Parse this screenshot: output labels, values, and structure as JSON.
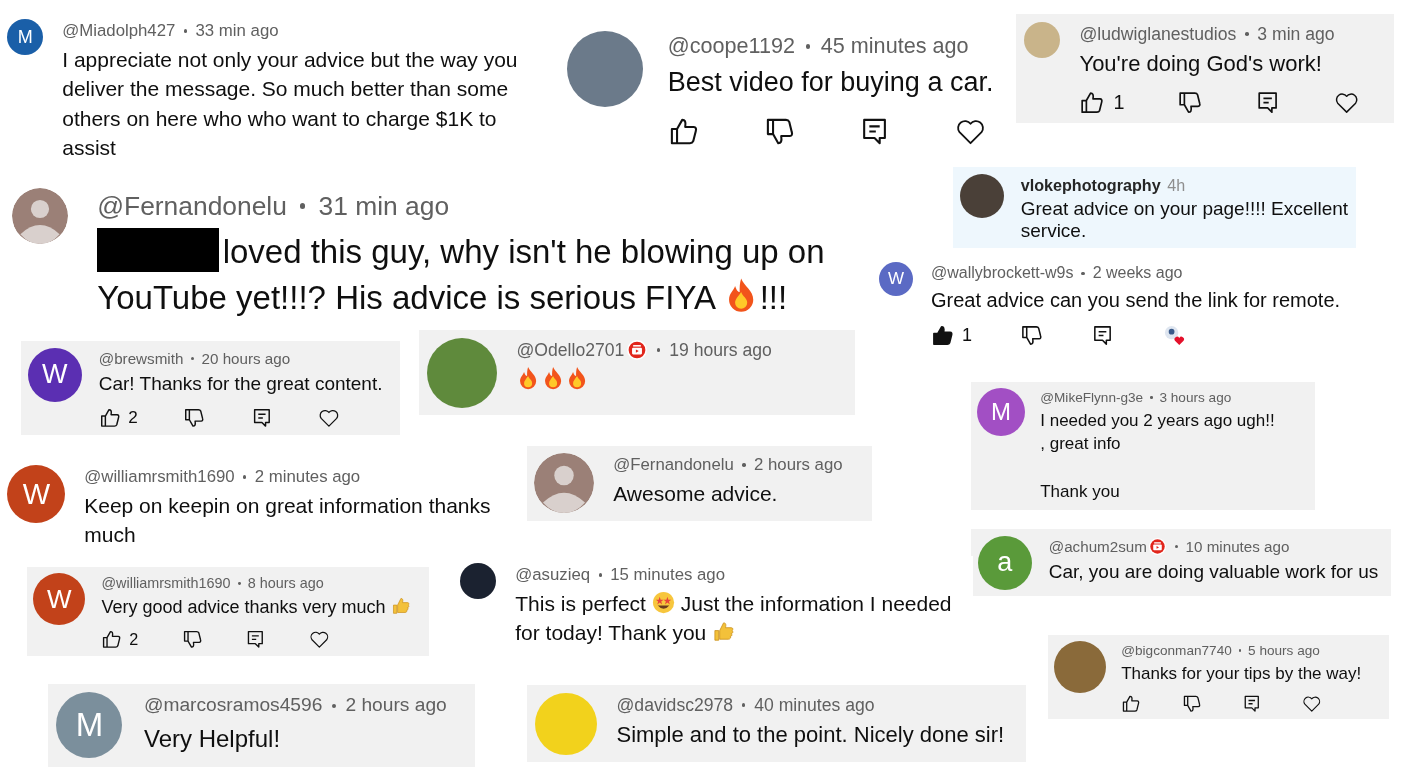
{
  "comments": [
    {
      "kind": "youtube",
      "avatar": {
        "kind": "letter",
        "letter": "M",
        "color": "#1a5fa8"
      },
      "handle": "@Miadolph427",
      "time": "33 min ago",
      "badge": false,
      "text": [
        {
          "kind": "text",
          "text": "I appreciate not only your advice but the way you deliver the message.  So much better than some others on here who who want to charge $1K to assist"
        }
      ]
    },
    {
      "kind": "youtube",
      "avatar": {
        "kind": "photo"
      },
      "handle": "@coope1192",
      "time": "45 minutes ago",
      "badge": false,
      "text": [
        {
          "kind": "text",
          "text": "Best video for buying a car."
        }
      ],
      "actions": {
        "liked": false,
        "creator_heart": false
      }
    },
    {
      "kind": "youtube",
      "avatar": {
        "kind": "photo"
      },
      "handle": "@ludwiglanestudios",
      "time": "3 min ago",
      "badge": false,
      "text": [
        {
          "kind": "text",
          "text": "You're doing God's work!"
        }
      ],
      "actions": {
        "liked": false,
        "count": "1",
        "creator_heart": false
      }
    },
    {
      "kind": "instagram",
      "avatar": {
        "kind": "photo"
      },
      "handle": "vlokephotography",
      "time": "4h",
      "text": [
        {
          "kind": "text",
          "text": "Great advice on your page!!!! Excellent service."
        }
      ]
    },
    {
      "kind": "youtube",
      "avatar": {
        "kind": "default"
      },
      "handle": "@Fernandonelu",
      "time": "31 min ago",
      "badge": false,
      "text": [
        {
          "kind": "redacted"
        },
        {
          "kind": "text",
          "text": "loved this guy, why isn't he blowing up on YouTube yet!!!? His advice is serious FIYA "
        },
        {
          "kind": "fire"
        },
        {
          "kind": "text",
          "text": "!!!"
        }
      ]
    },
    {
      "kind": "youtube",
      "avatar": {
        "kind": "letter",
        "letter": "W",
        "color": "#5b6ac4"
      },
      "handle": "@wallybrockett-w9s",
      "time": "2 weeks ago",
      "badge": false,
      "text": [
        {
          "kind": "text",
          "text": "Great advice can you send the link for remote."
        }
      ],
      "actions": {
        "liked": true,
        "count": "1",
        "creator_heart": true
      }
    },
    {
      "kind": "youtube",
      "avatar": {
        "kind": "letter",
        "letter": "W",
        "color": "#5b2fb2"
      },
      "handle": "@brewsmith",
      "time": "20 hours ago",
      "badge": false,
      "text": [
        {
          "kind": "text",
          "text": "Car! Thanks for the great content."
        }
      ],
      "actions": {
        "liked": false,
        "count": "2",
        "creator_heart": false
      }
    },
    {
      "kind": "youtube",
      "avatar": {
        "kind": "photo"
      },
      "handle": "@Odello2701",
      "time": "19 hours ago",
      "badge": true,
      "text": [
        {
          "kind": "fire"
        },
        {
          "kind": "fire"
        },
        {
          "kind": "fire"
        }
      ]
    },
    {
      "kind": "youtube",
      "avatar": {
        "kind": "letter",
        "letter": "M",
        "color": "#a24fc4"
      },
      "handle": "@MikeFlynn-g3e",
      "time": "3 hours ago",
      "badge": false,
      "text": [
        {
          "kind": "text",
          "text": "I needed you 2 years ago ugh!!\n,  great info\n\nThank you"
        }
      ]
    },
    {
      "kind": "youtube",
      "avatar": {
        "kind": "letter",
        "letter": "W",
        "color": "#c2421a"
      },
      "handle": "@williamrsmith1690",
      "time": "2 minutes ago",
      "badge": false,
      "text": [
        {
          "kind": "text",
          "text": "Keep on keepin on great information thanks much"
        }
      ]
    },
    {
      "kind": "youtube",
      "avatar": {
        "kind": "default"
      },
      "handle": "@Fernandonelu",
      "time": "2 hours ago",
      "badge": false,
      "text": [
        {
          "kind": "text",
          "text": "Awesome advice."
        }
      ]
    },
    {
      "kind": "youtube",
      "avatar": {
        "kind": "letter",
        "letter": "a",
        "color": "#5a9a3a"
      },
      "handle": "@achum2sum",
      "time": "10 minutes ago",
      "badge": true,
      "text": [
        {
          "kind": "text",
          "text": "Car, you are doing valuable work for us"
        }
      ]
    },
    {
      "kind": "youtube",
      "avatar": {
        "kind": "letter",
        "letter": "W",
        "color": "#c2421a"
      },
      "handle": "@williamrsmith1690",
      "time": "8 hours ago",
      "badge": false,
      "text": [
        {
          "kind": "text",
          "text": "Very good advice thanks very much "
        },
        {
          "kind": "thumbs"
        }
      ],
      "actions": {
        "liked": false,
        "count": "2",
        "creator_heart": false
      }
    },
    {
      "kind": "youtube",
      "avatar": {
        "kind": "photo"
      },
      "handle": "@asuzieq",
      "time": "15 minutes ago",
      "badge": false,
      "text": [
        {
          "kind": "text",
          "text": "This is perfect "
        },
        {
          "kind": "star-eyes"
        },
        {
          "kind": "text",
          "text": " Just the information I needed for today! Thank you "
        },
        {
          "kind": "thumbs"
        }
      ]
    },
    {
      "kind": "youtube",
      "avatar": {
        "kind": "photo"
      },
      "handle": "@bigconman7740",
      "time": "5 hours ago",
      "badge": false,
      "text": [
        {
          "kind": "text",
          "text": "Thanks for your tips by the way!"
        }
      ],
      "actions": {
        "liked": false,
        "creator_heart": false
      }
    },
    {
      "kind": "youtube",
      "avatar": {
        "kind": "letter",
        "letter": "M",
        "color": "#7b8f9c"
      },
      "handle": "@marcosramos4596",
      "time": "2 hours ago",
      "badge": false,
      "text": [
        {
          "kind": "text",
          "text": "Very Helpful!"
        }
      ]
    },
    {
      "kind": "youtube",
      "avatar": {
        "kind": "photo"
      },
      "handle": "@davidsc2978",
      "time": "40 minutes ago",
      "badge": false,
      "text": [
        {
          "kind": "text",
          "text": "Simple and to the point. Nicely done sir!"
        }
      ]
    }
  ]
}
